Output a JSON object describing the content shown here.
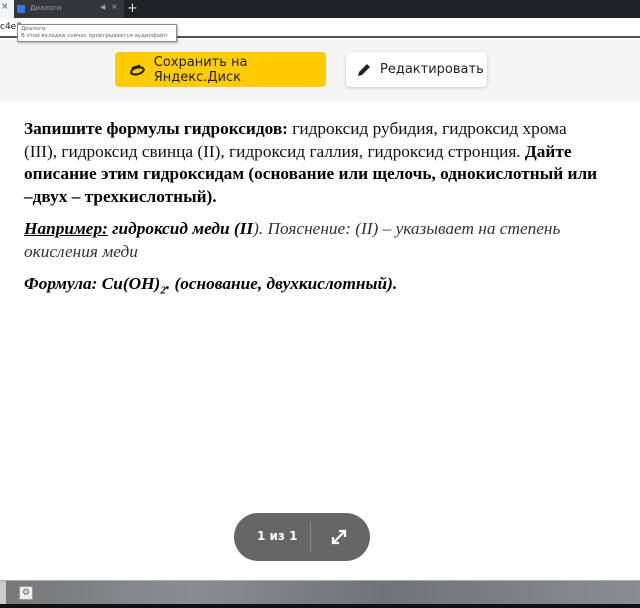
{
  "browser": {
    "prev_tab_close": "×",
    "tab_title": "Диалоги",
    "tab_audio_icon": "speaker-icon",
    "tab_close": "×",
    "new_tab": "+",
    "address_fragment": "c4e2",
    "tooltip_title": "Диалоги",
    "tooltip_text": "В этой вкладке сейчас проигрывается аудиофайл"
  },
  "toolbar": {
    "save_label": "Сохранить на Яндекс.Диск",
    "edit_label": "Редактировать",
    "save_color": "#ffcc00"
  },
  "document": {
    "p1": {
      "l1a": "Запишите формулы гидроксидов:",
      "l1b": " гидроксид рубидия, гидроксид хрома",
      "l2a": "(III), гидроксид свинца (II), гидроксид галлия, гидроксид стронция. ",
      "l2b": "Дайте",
      "l3": "описание этим гидроксидам (основание или щелочь, однокислотный или",
      "l4": "–двух – трехкислотный)."
    },
    "p2": {
      "l1a": "Например:",
      "l1b": " гидроксид меди (II",
      "l1c": "). Пояснение: (II) – указывает на степень",
      "l2": "окисления меди"
    },
    "p3": {
      "l1a": "Формула: Cu(OH)",
      "l1sub": "2",
      "l1b": ". (основание, двухкислотный)."
    }
  },
  "pager": {
    "text": "1 из 1"
  }
}
